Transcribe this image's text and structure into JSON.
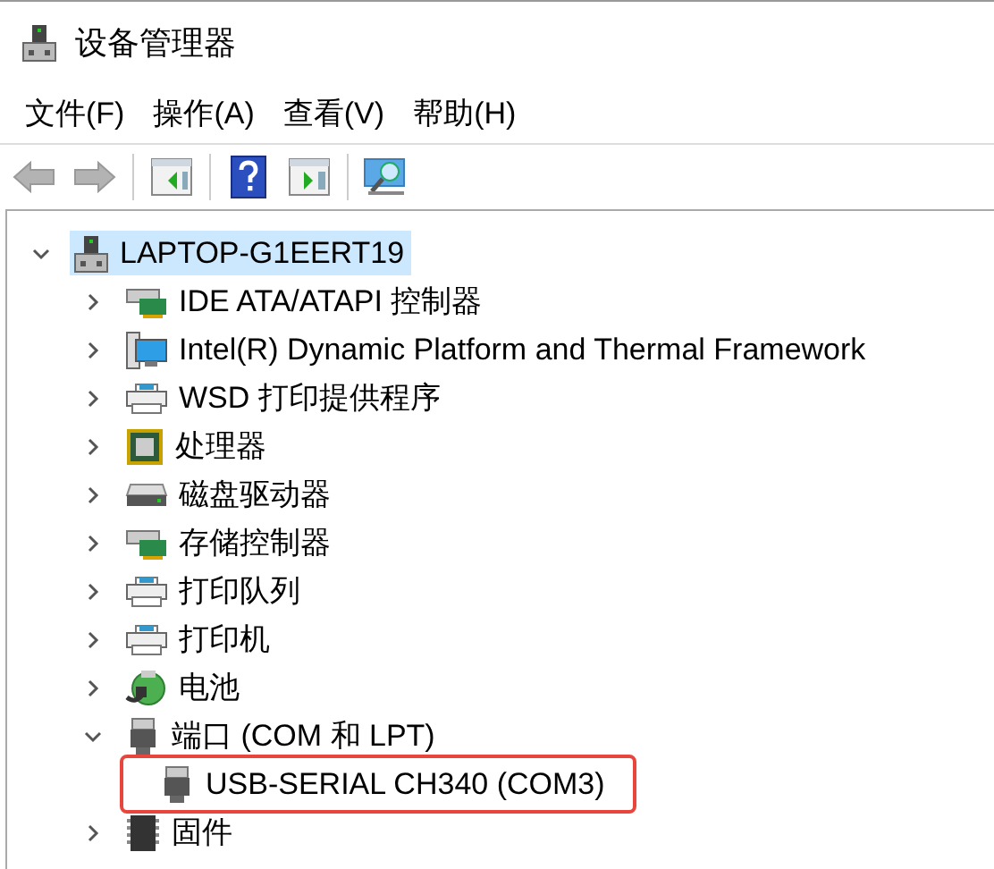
{
  "window": {
    "title": "设备管理器"
  },
  "menu": [
    "文件(F)",
    "操作(A)",
    "查看(V)",
    "帮助(H)"
  ],
  "toolbar": [
    {
      "kind": "back",
      "disabled": true
    },
    {
      "kind": "forward",
      "disabled": true
    },
    {
      "kind": "separator"
    },
    {
      "kind": "tree-pane",
      "disabled": false
    },
    {
      "kind": "separator"
    },
    {
      "kind": "help",
      "disabled": false
    },
    {
      "kind": "action-pane",
      "disabled": false
    },
    {
      "kind": "separator"
    },
    {
      "kind": "scan",
      "disabled": false
    }
  ],
  "tree": [
    {
      "label": "LAPTOP-G1EERT19",
      "kind": "computer",
      "expanded": true,
      "selected": true,
      "children": [
        {
          "label": "IDE ATA/ATAPI 控制器",
          "kind": "card",
          "expanded": false,
          "selected": false
        },
        {
          "label": "Intel(R) Dynamic Platform and Thermal Framework",
          "kind": "monitor",
          "expanded": false,
          "selected": false
        },
        {
          "label": "WSD 打印提供程序",
          "kind": "printer",
          "expanded": false,
          "selected": false
        },
        {
          "label": "处理器",
          "kind": "chip",
          "expanded": false,
          "selected": false
        },
        {
          "label": "磁盘驱动器",
          "kind": "disk",
          "expanded": false,
          "selected": false
        },
        {
          "label": "存储控制器",
          "kind": "storage",
          "expanded": false,
          "selected": false
        },
        {
          "label": "打印队列",
          "kind": "printer",
          "expanded": false,
          "selected": false
        },
        {
          "label": "打印机",
          "kind": "printer",
          "expanded": false,
          "selected": false
        },
        {
          "label": "电池",
          "kind": "battery",
          "expanded": false,
          "selected": false
        },
        {
          "label": "端口 (COM 和 LPT)",
          "kind": "port",
          "expanded": true,
          "selected": false,
          "children": [
            {
              "label": "USB-SERIAL CH340 (COM3)",
              "kind": "port",
              "selected": false,
              "annotated": true
            }
          ]
        },
        {
          "label": "固件",
          "kind": "firmware",
          "expanded": false,
          "selected": false
        }
      ]
    }
  ]
}
